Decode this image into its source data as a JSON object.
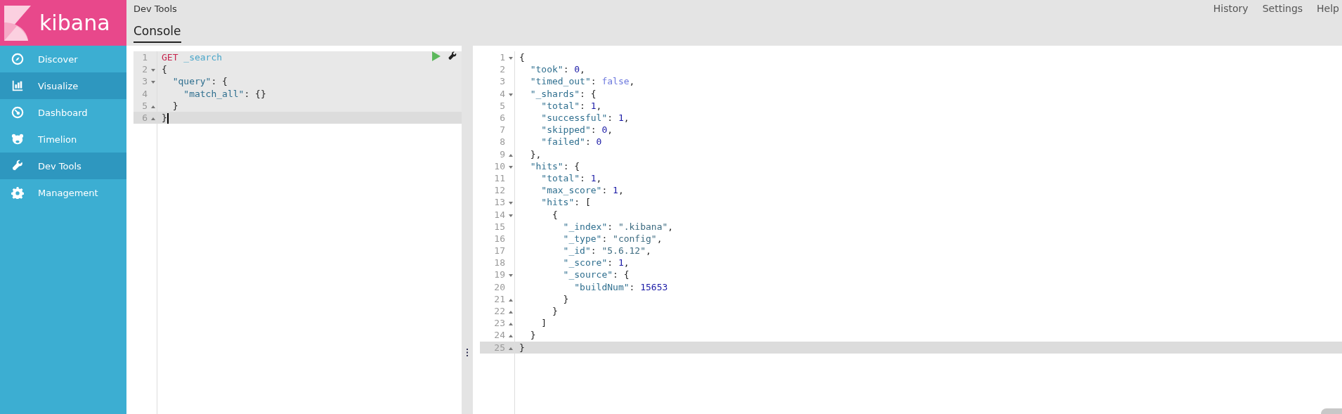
{
  "brand": {
    "name": "kibana"
  },
  "nav": [
    {
      "label": "Discover",
      "kind": "compass",
      "selected": false
    },
    {
      "label": "Visualize",
      "kind": "chart",
      "selected": true
    },
    {
      "label": "Dashboard",
      "kind": "gauge",
      "selected": false
    },
    {
      "label": "Timelion",
      "kind": "bear",
      "selected": false
    },
    {
      "label": "Dev Tools",
      "kind": "wrench",
      "selected": true
    },
    {
      "label": "Management",
      "kind": "gear",
      "selected": false
    }
  ],
  "header": {
    "breadcrumb": "Dev Tools",
    "links": [
      "History",
      "Settings",
      "Help"
    ],
    "tabs": [
      {
        "label": "Console",
        "selected": true
      }
    ]
  },
  "request": {
    "lines": [
      {
        "number": "1",
        "fold_start": false,
        "fold_end": false,
        "current": false,
        "tokens": [
          {
            "kind": "method",
            "text": "GET"
          },
          {
            "kind": "url",
            "text": " _search"
          }
        ]
      },
      {
        "number": "2",
        "fold_start": true,
        "fold_end": false,
        "current": false,
        "tokens": [
          {
            "kind": "punct",
            "text": "{"
          }
        ]
      },
      {
        "number": "3",
        "fold_start": true,
        "fold_end": false,
        "current": false,
        "tokens": [
          {
            "kind": "key",
            "text": "  \"query\""
          },
          {
            "kind": "punct",
            "text": ": {"
          }
        ]
      },
      {
        "number": "4",
        "fold_start": false,
        "fold_end": false,
        "current": false,
        "tokens": [
          {
            "kind": "key",
            "text": "    \"match_all\""
          },
          {
            "kind": "punct",
            "text": ": {}"
          }
        ]
      },
      {
        "number": "5",
        "fold_start": false,
        "fold_end": true,
        "current": false,
        "tokens": [
          {
            "kind": "punct",
            "text": "  }"
          }
        ]
      },
      {
        "number": "6",
        "fold_start": false,
        "fold_end": true,
        "current": true,
        "tokens": [
          {
            "kind": "punct",
            "text": "}"
          }
        ]
      }
    ]
  },
  "response": {
    "lines": [
      {
        "number": "1",
        "fold_start": true,
        "fold_end": false,
        "current": false,
        "tokens": [
          {
            "kind": "punct",
            "text": "{"
          }
        ]
      },
      {
        "number": "2",
        "fold_start": false,
        "fold_end": false,
        "current": false,
        "tokens": [
          {
            "kind": "key",
            "text": "  \"took\""
          },
          {
            "kind": "punct",
            "text": ": "
          },
          {
            "kind": "number",
            "text": "0"
          },
          {
            "kind": "punct",
            "text": ","
          }
        ]
      },
      {
        "number": "3",
        "fold_start": false,
        "fold_end": false,
        "current": false,
        "tokens": [
          {
            "kind": "key",
            "text": "  \"timed_out\""
          },
          {
            "kind": "punct",
            "text": ": "
          },
          {
            "kind": "boolean",
            "text": "false"
          },
          {
            "kind": "punct",
            "text": ","
          }
        ]
      },
      {
        "number": "4",
        "fold_start": true,
        "fold_end": false,
        "current": false,
        "tokens": [
          {
            "kind": "key",
            "text": "  \"_shards\""
          },
          {
            "kind": "punct",
            "text": ": {"
          }
        ]
      },
      {
        "number": "5",
        "fold_start": false,
        "fold_end": false,
        "current": false,
        "tokens": [
          {
            "kind": "key",
            "text": "    \"total\""
          },
          {
            "kind": "punct",
            "text": ": "
          },
          {
            "kind": "number",
            "text": "1"
          },
          {
            "kind": "punct",
            "text": ","
          }
        ]
      },
      {
        "number": "6",
        "fold_start": false,
        "fold_end": false,
        "current": false,
        "tokens": [
          {
            "kind": "key",
            "text": "    \"successful\""
          },
          {
            "kind": "punct",
            "text": ": "
          },
          {
            "kind": "number",
            "text": "1"
          },
          {
            "kind": "punct",
            "text": ","
          }
        ]
      },
      {
        "number": "7",
        "fold_start": false,
        "fold_end": false,
        "current": false,
        "tokens": [
          {
            "kind": "key",
            "text": "    \"skipped\""
          },
          {
            "kind": "punct",
            "text": ": "
          },
          {
            "kind": "number",
            "text": "0"
          },
          {
            "kind": "punct",
            "text": ","
          }
        ]
      },
      {
        "number": "8",
        "fold_start": false,
        "fold_end": false,
        "current": false,
        "tokens": [
          {
            "kind": "key",
            "text": "    \"failed\""
          },
          {
            "kind": "punct",
            "text": ": "
          },
          {
            "kind": "number",
            "text": "0"
          }
        ]
      },
      {
        "number": "9",
        "fold_start": false,
        "fold_end": true,
        "current": false,
        "tokens": [
          {
            "kind": "punct",
            "text": "  },"
          }
        ]
      },
      {
        "number": "10",
        "fold_start": true,
        "fold_end": false,
        "current": false,
        "tokens": [
          {
            "kind": "key",
            "text": "  \"hits\""
          },
          {
            "kind": "punct",
            "text": ": {"
          }
        ]
      },
      {
        "number": "11",
        "fold_start": false,
        "fold_end": false,
        "current": false,
        "tokens": [
          {
            "kind": "key",
            "text": "    \"total\""
          },
          {
            "kind": "punct",
            "text": ": "
          },
          {
            "kind": "number",
            "text": "1"
          },
          {
            "kind": "punct",
            "text": ","
          }
        ]
      },
      {
        "number": "12",
        "fold_start": false,
        "fold_end": false,
        "current": false,
        "tokens": [
          {
            "kind": "key",
            "text": "    \"max_score\""
          },
          {
            "kind": "punct",
            "text": ": "
          },
          {
            "kind": "number",
            "text": "1"
          },
          {
            "kind": "punct",
            "text": ","
          }
        ]
      },
      {
        "number": "13",
        "fold_start": true,
        "fold_end": false,
        "current": false,
        "tokens": [
          {
            "kind": "key",
            "text": "    \"hits\""
          },
          {
            "kind": "punct",
            "text": ": ["
          }
        ]
      },
      {
        "number": "14",
        "fold_start": true,
        "fold_end": false,
        "current": false,
        "tokens": [
          {
            "kind": "punct",
            "text": "      {"
          }
        ]
      },
      {
        "number": "15",
        "fold_start": false,
        "fold_end": false,
        "current": false,
        "tokens": [
          {
            "kind": "key",
            "text": "        \"_index\""
          },
          {
            "kind": "punct",
            "text": ": "
          },
          {
            "kind": "string",
            "text": "\".kibana\""
          },
          {
            "kind": "punct",
            "text": ","
          }
        ]
      },
      {
        "number": "16",
        "fold_start": false,
        "fold_end": false,
        "current": false,
        "tokens": [
          {
            "kind": "key",
            "text": "        \"_type\""
          },
          {
            "kind": "punct",
            "text": ": "
          },
          {
            "kind": "string",
            "text": "\"config\""
          },
          {
            "kind": "punct",
            "text": ","
          }
        ]
      },
      {
        "number": "17",
        "fold_start": false,
        "fold_end": false,
        "current": false,
        "tokens": [
          {
            "kind": "key",
            "text": "        \"_id\""
          },
          {
            "kind": "punct",
            "text": ": "
          },
          {
            "kind": "string",
            "text": "\"5.6.12\""
          },
          {
            "kind": "punct",
            "text": ","
          }
        ]
      },
      {
        "number": "18",
        "fold_start": false,
        "fold_end": false,
        "current": false,
        "tokens": [
          {
            "kind": "key",
            "text": "        \"_score\""
          },
          {
            "kind": "punct",
            "text": ": "
          },
          {
            "kind": "number",
            "text": "1"
          },
          {
            "kind": "punct",
            "text": ","
          }
        ]
      },
      {
        "number": "19",
        "fold_start": true,
        "fold_end": false,
        "current": false,
        "tokens": [
          {
            "kind": "key",
            "text": "        \"_source\""
          },
          {
            "kind": "punct",
            "text": ": {"
          }
        ]
      },
      {
        "number": "20",
        "fold_start": false,
        "fold_end": false,
        "current": false,
        "tokens": [
          {
            "kind": "key",
            "text": "          \"buildNum\""
          },
          {
            "kind": "punct",
            "text": ": "
          },
          {
            "kind": "number",
            "text": "15653"
          }
        ]
      },
      {
        "number": "21",
        "fold_start": false,
        "fold_end": true,
        "current": false,
        "tokens": [
          {
            "kind": "punct",
            "text": "        }"
          }
        ]
      },
      {
        "number": "22",
        "fold_start": false,
        "fold_end": true,
        "current": false,
        "tokens": [
          {
            "kind": "punct",
            "text": "      }"
          }
        ]
      },
      {
        "number": "23",
        "fold_start": false,
        "fold_end": true,
        "current": false,
        "tokens": [
          {
            "kind": "punct",
            "text": "    ]"
          }
        ]
      },
      {
        "number": "24",
        "fold_start": false,
        "fold_end": true,
        "current": false,
        "tokens": [
          {
            "kind": "punct",
            "text": "  }"
          }
        ]
      },
      {
        "number": "25",
        "fold_start": false,
        "fold_end": true,
        "current": true,
        "tokens": [
          {
            "kind": "punct",
            "text": "}"
          }
        ]
      }
    ]
  }
}
